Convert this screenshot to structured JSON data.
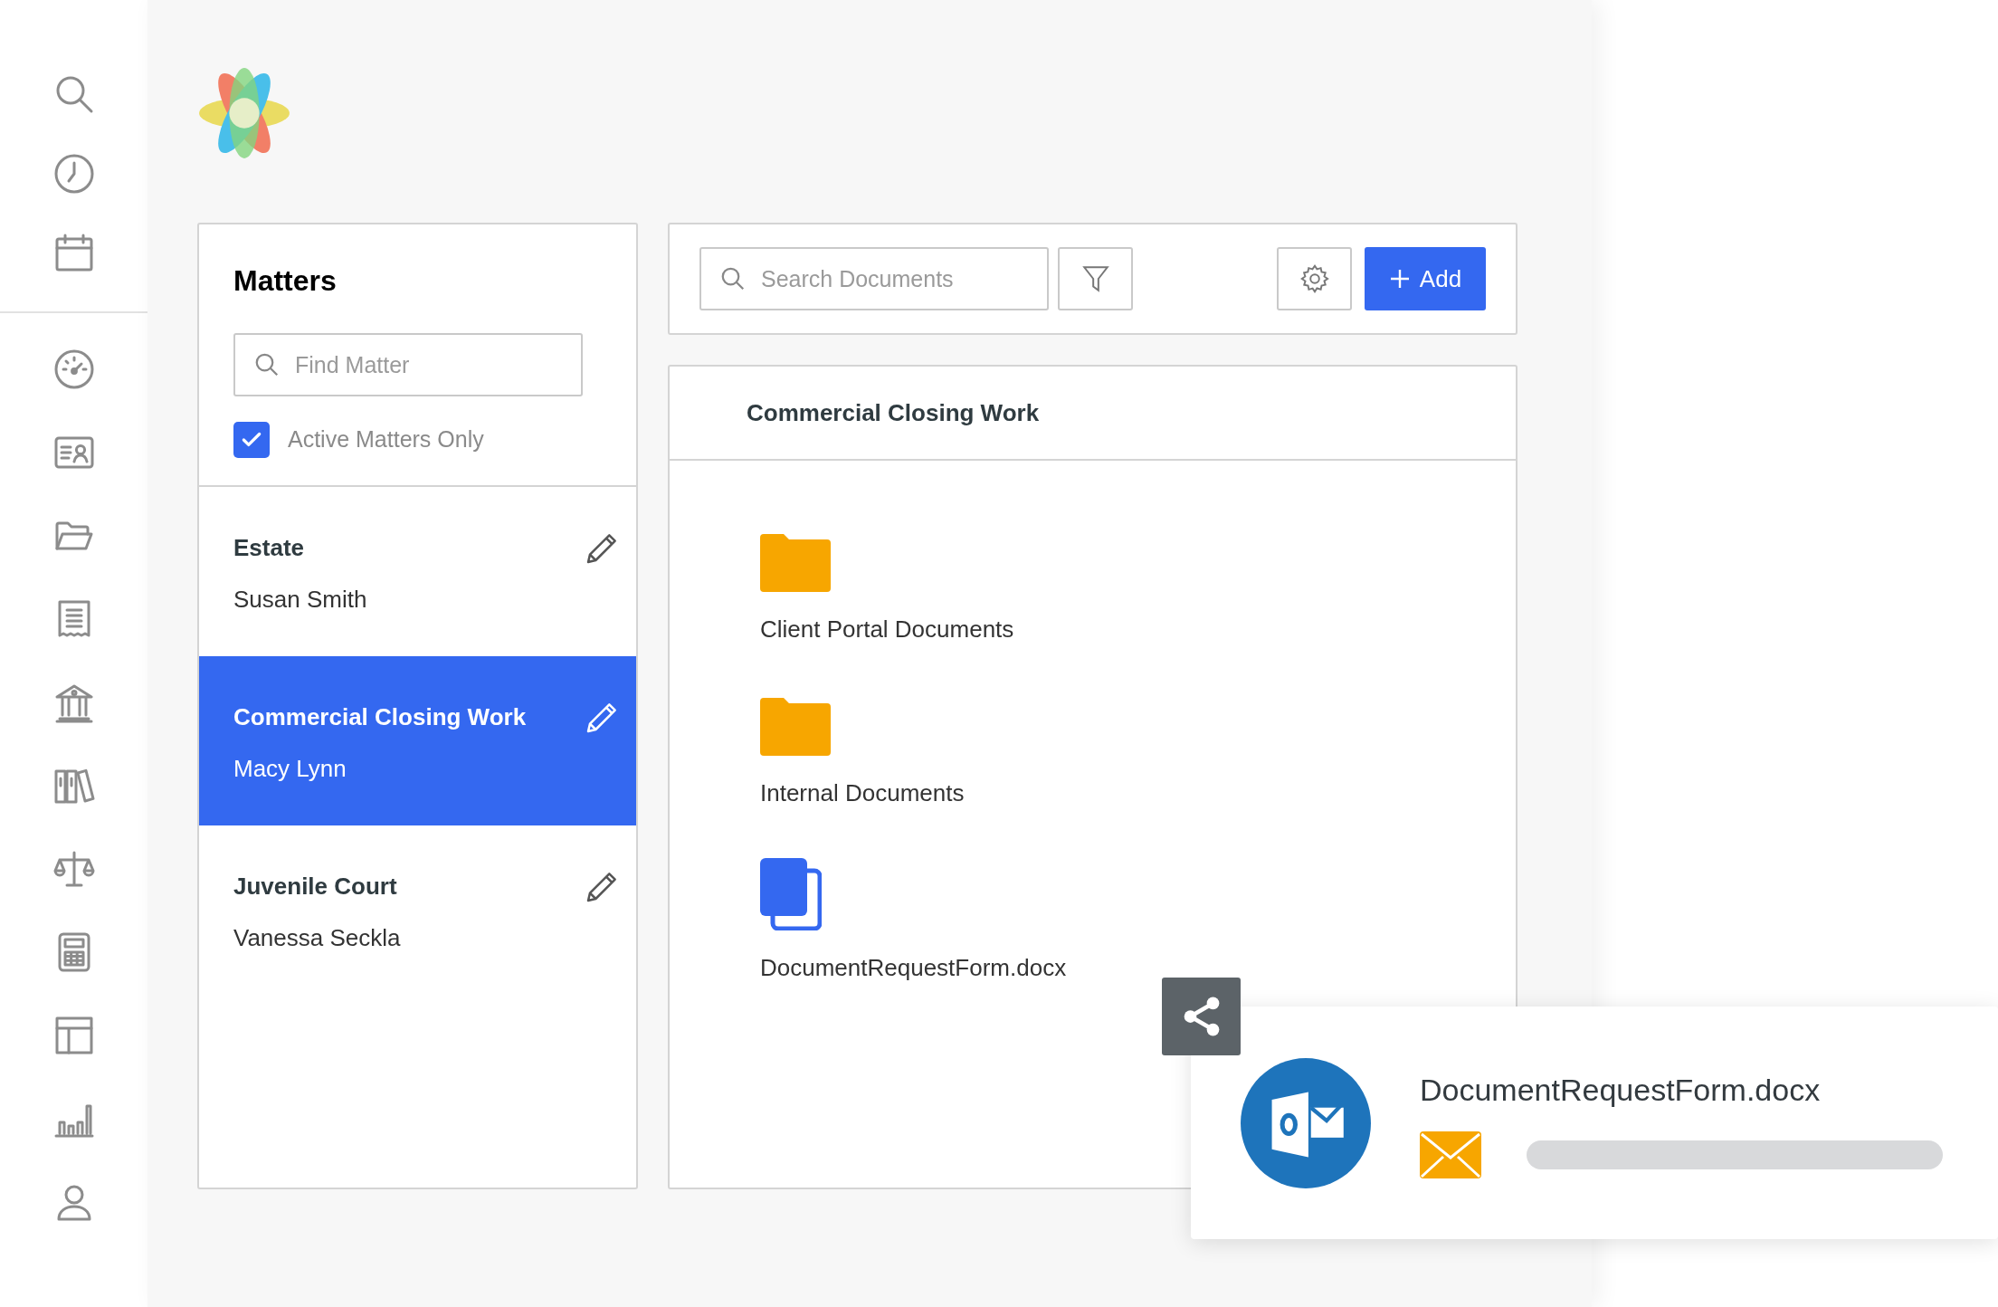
{
  "matters": {
    "title": "Matters",
    "search": {
      "placeholder": "Find Matter"
    },
    "active_only": {
      "label": "Active Matters Only",
      "checked": true
    },
    "items": [
      {
        "title": "Estate",
        "client": "Susan Smith",
        "selected": false
      },
      {
        "title": "Commercial Closing Work",
        "client": "Macy Lynn",
        "selected": true
      },
      {
        "title": "Juvenile Court",
        "client": "Vanessa Seckla",
        "selected": false
      }
    ]
  },
  "documents": {
    "search": {
      "placeholder": "Search Documents"
    },
    "add_button": "Add",
    "folder_title": "Commercial Closing Work",
    "items": [
      {
        "kind": "folder",
        "name": "Client Portal Documents"
      },
      {
        "kind": "folder",
        "name": "Internal Documents"
      },
      {
        "kind": "file",
        "name": "DocumentRequestForm.docx"
      }
    ]
  },
  "share_card": {
    "file_name": "DocumentRequestForm.docx"
  }
}
